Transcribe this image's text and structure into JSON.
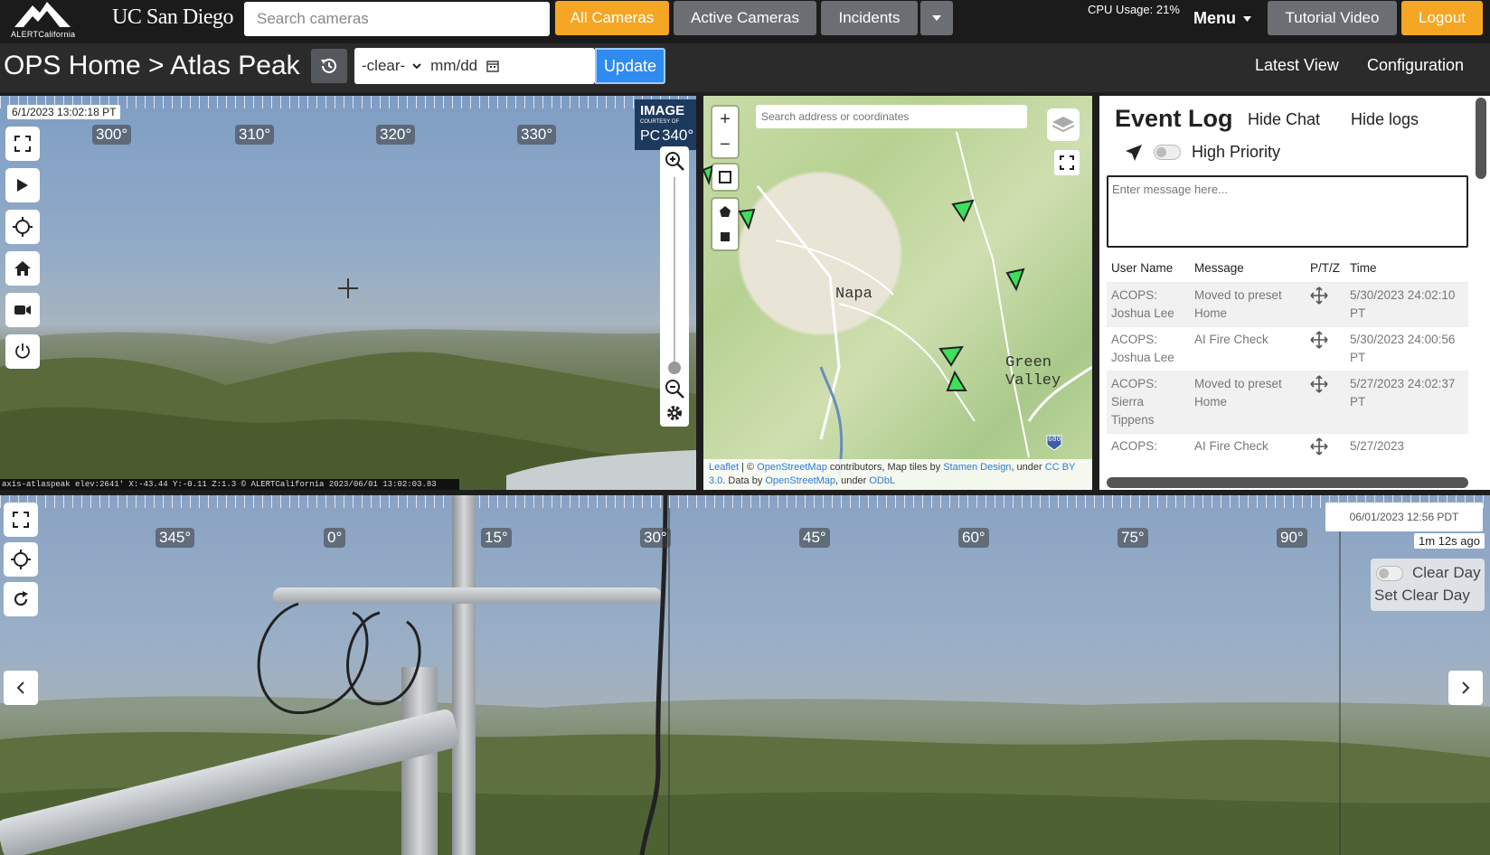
{
  "nav": {
    "logo_text": "ALERTCalifornia",
    "org": "UC San Diego",
    "search_placeholder": "Search cameras",
    "buttons": {
      "all": "All Cameras",
      "active": "Active Cameras",
      "incidents": "Incidents",
      "tutorial": "Tutorial Video",
      "logout": "Logout"
    },
    "cpu": "CPU Usage: 21%",
    "menu": "Menu"
  },
  "subbar": {
    "breadcrumb": "OPS Home > Atlas Peak",
    "select_value": "-clear-",
    "date_placeholder": "mm/dd",
    "update": "Update",
    "latest_view": "Latest View",
    "configuration": "Configuration"
  },
  "top_cam": {
    "timestamp": "6/1/2023 13:02:18 PT",
    "degrees": [
      "300°",
      "310°",
      "320°",
      "330°",
      "340°"
    ],
    "badge_big": "IMAGE",
    "badge_small": "COURTESY OF",
    "badge_pc": "PC",
    "info": "axis-atlaspeak elev:2641' X:-43.44 Y:-0.11 Z:1.3  © ALERTCalifornia 2023/06/01 13:02:03.83"
  },
  "map": {
    "search_placeholder": "Search address or coordinates",
    "labels": {
      "napa": "Napa",
      "green": "Green",
      "valley": "Valley",
      "highway": "680"
    },
    "attrib": {
      "leaflet": "Leaflet",
      "osm": "OpenStreetMap",
      "contrib": " contributors, Map tiles by ",
      "stamen": "Stamen Design",
      "under": ", under ",
      "cc": "CC BY 3.0",
      "data_by": ". Data by ",
      "osm2": "OpenStreetMap",
      "under2": ", under ",
      "odbl": "ODbL"
    }
  },
  "event_log": {
    "title": "Event Log",
    "hide_chat": "Hide Chat",
    "hide_logs": "Hide logs",
    "high_priority": "High Priority",
    "message_placeholder": "Enter message here...",
    "columns": [
      "User Name",
      "Message",
      "P/T/Z",
      "Time"
    ],
    "rows": [
      {
        "user": "ACOPS: Joshua Lee",
        "message": "Moved to preset Home",
        "time": "5/30/2023 24:02:10 PT"
      },
      {
        "user": "ACOPS: Joshua Lee",
        "message": "AI Fire Check",
        "time": "5/30/2023 24:00:56 PT"
      },
      {
        "user": "ACOPS: Sierra Tippens",
        "message": "Moved to preset Home",
        "time": "5/27/2023 24:02:37 PT"
      },
      {
        "user": "ACOPS:",
        "message": "AI Fire Check",
        "time": "5/27/2023"
      }
    ]
  },
  "bottom_cam": {
    "degrees": [
      "345°",
      "0°",
      "15°",
      "30°",
      "45°",
      "60°",
      "75°",
      "90°"
    ],
    "timestamp": "06/01/2023 12:56 PDT",
    "ago": "1m 12s ago",
    "clear_day": "Clear Day",
    "set_clear_day": "Set Clear Day"
  },
  "colors": {
    "orange": "#f5a623",
    "gray": "#6b6f73",
    "blue": "#2f8bf0",
    "marker_green": "#3de05a"
  }
}
